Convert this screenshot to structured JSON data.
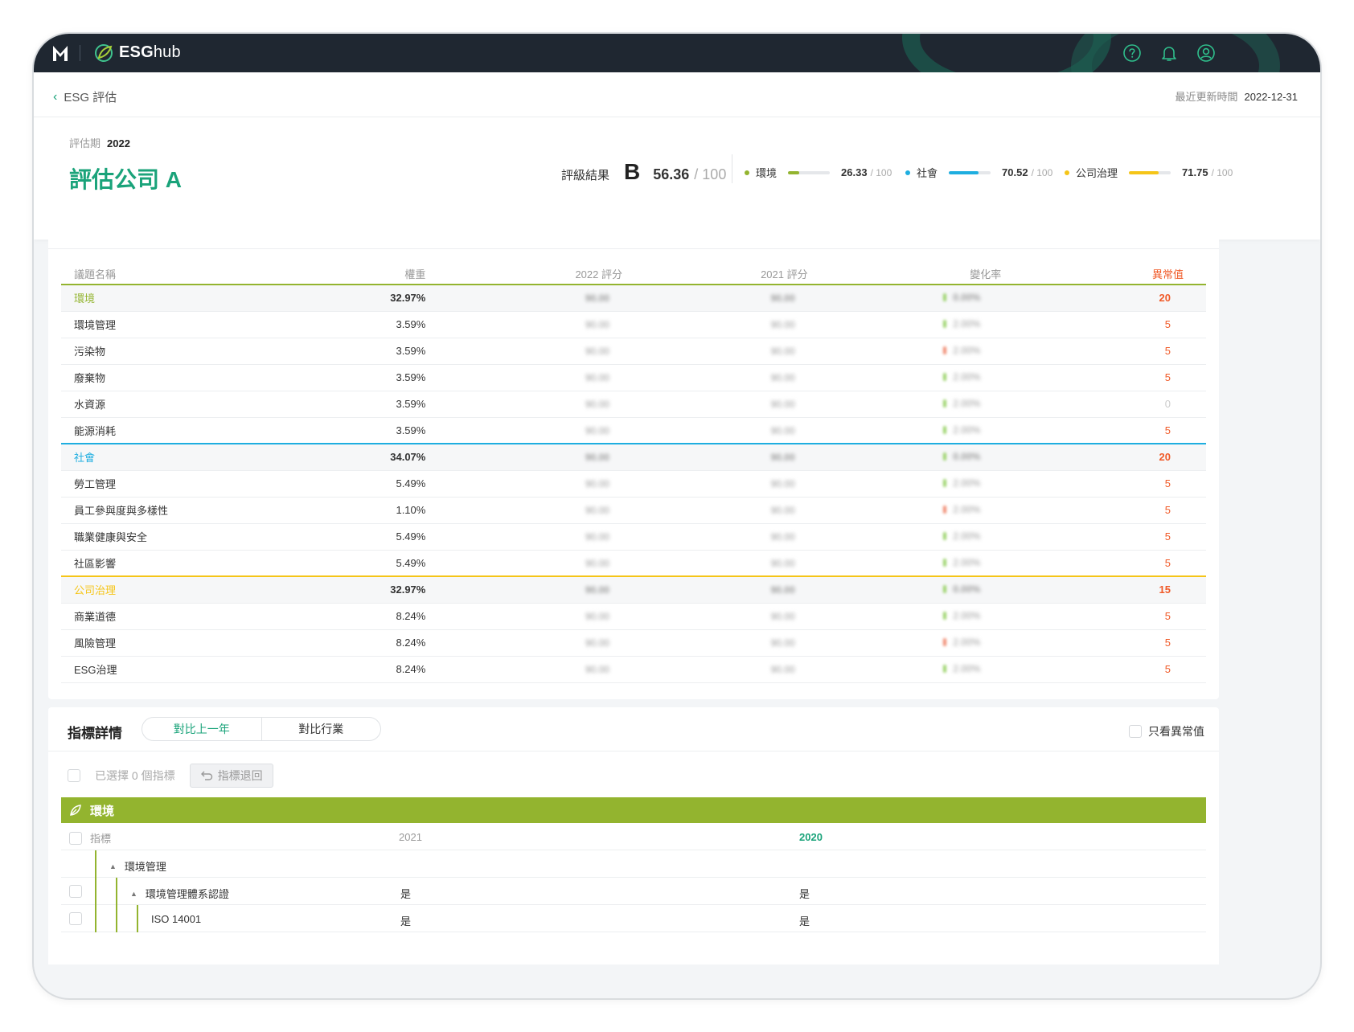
{
  "app": {
    "brand_bold": "ESG",
    "brand_light": "hub"
  },
  "header": {
    "back_label": "ESG 評估",
    "updated_label": "最近更新時間",
    "updated_value": "2022-12-31"
  },
  "summary": {
    "period_label": "評估期",
    "period_value": "2022",
    "company": "評估公司 A",
    "rating_label": "評級結果",
    "grade": "B",
    "score": "56.36",
    "score_max": "/ 100",
    "pillars": [
      {
        "label": "環境",
        "value": "26.33",
        "max": "/ 100",
        "fraction": 0.2633,
        "color": "#93b42f"
      },
      {
        "label": "社會",
        "value": "70.52",
        "max": "/ 100",
        "fraction": 0.7052,
        "color": "#1eaee0"
      },
      {
        "label": "公司治理",
        "value": "71.75",
        "max": "/ 100",
        "fraction": 0.7175,
        "color": "#f5c518"
      }
    ]
  },
  "table": {
    "headers": [
      "議題名稱",
      "權重",
      "2022 評分",
      "2021 評分",
      "變化率",
      "異常值"
    ],
    "rows": [
      {
        "name": "環境",
        "weight": "32.97%",
        "s2022": "90.00",
        "s2021": "90.00",
        "change": "0.00%",
        "anomaly": "20",
        "category": true,
        "color": "#93b42f",
        "dir": "up"
      },
      {
        "name": "環境管理",
        "weight": "3.59%",
        "s2022": "90.00",
        "s2021": "90.00",
        "change": "2.00%",
        "anomaly": "5",
        "dir": "up"
      },
      {
        "name": "污染物",
        "weight": "3.59%",
        "s2022": "90.00",
        "s2021": "90.00",
        "change": "2.00%",
        "anomaly": "5",
        "dir": "down"
      },
      {
        "name": "廢棄物",
        "weight": "3.59%",
        "s2022": "90.00",
        "s2021": "90.00",
        "change": "2.00%",
        "anomaly": "5",
        "dir": "up"
      },
      {
        "name": "水資源",
        "weight": "3.59%",
        "s2022": "90.00",
        "s2021": "90.00",
        "change": "2.00%",
        "anomaly": "0",
        "dir": "up"
      },
      {
        "name": "能源消耗",
        "weight": "3.59%",
        "s2022": "90.00",
        "s2021": "90.00",
        "change": "2.00%",
        "anomaly": "5",
        "dir": "up"
      },
      {
        "name": "社會",
        "weight": "34.07%",
        "s2022": "90.00",
        "s2021": "90.00",
        "change": "0.00%",
        "anomaly": "20",
        "category": true,
        "color": "#1eaee0",
        "dir": "up"
      },
      {
        "name": "勞工管理",
        "weight": "5.49%",
        "s2022": "90.00",
        "s2021": "90.00",
        "change": "2.00%",
        "anomaly": "5",
        "dir": "up"
      },
      {
        "name": "員工參與度與多樣性",
        "weight": "1.10%",
        "s2022": "90.00",
        "s2021": "90.00",
        "change": "2.00%",
        "anomaly": "5",
        "dir": "down"
      },
      {
        "name": "職業健康與安全",
        "weight": "5.49%",
        "s2022": "90.00",
        "s2021": "90.00",
        "change": "2.00%",
        "anomaly": "5",
        "dir": "up"
      },
      {
        "name": "社區影響",
        "weight": "5.49%",
        "s2022": "90.00",
        "s2021": "90.00",
        "change": "2.00%",
        "anomaly": "5",
        "dir": "up"
      },
      {
        "name": "公司治理",
        "weight": "32.97%",
        "s2022": "90.00",
        "s2021": "90.00",
        "change": "0.00%",
        "anomaly": "15",
        "category": true,
        "color": "#f5c518",
        "dir": "up"
      },
      {
        "name": "商業道德",
        "weight": "8.24%",
        "s2022": "90.00",
        "s2021": "90.00",
        "change": "2.00%",
        "anomaly": "5",
        "dir": "up"
      },
      {
        "name": "風險管理",
        "weight": "8.24%",
        "s2022": "90.00",
        "s2021": "90.00",
        "change": "2.00%",
        "anomaly": "5",
        "dir": "down"
      },
      {
        "name": "ESG治理",
        "weight": "8.24%",
        "s2022": "90.00",
        "s2021": "90.00",
        "change": "2.00%",
        "anomaly": "5",
        "dir": "up"
      }
    ]
  },
  "details": {
    "title": "指標詳情",
    "tab_prev_year": "對比上一年",
    "tab_industry": "對比行業",
    "only_anomaly": "只看異常值",
    "selected_text": "已選擇 0 個指標",
    "revert_label": "指標退回",
    "section": "環境",
    "columns": {
      "indicator": "指標",
      "y1": "2021",
      "y2": "2020"
    },
    "rows": [
      {
        "label": "環境管理",
        "level": 1,
        "expand": true,
        "v1": "",
        "v2": "",
        "checkbox": false
      },
      {
        "label": "環境管理體系認證",
        "level": 2,
        "expand": true,
        "v1": "是",
        "v2": "是",
        "checkbox": true
      },
      {
        "label": "ISO 14001",
        "level": 3,
        "expand": false,
        "v1": "是",
        "v2": "是",
        "checkbox": true
      }
    ]
  }
}
